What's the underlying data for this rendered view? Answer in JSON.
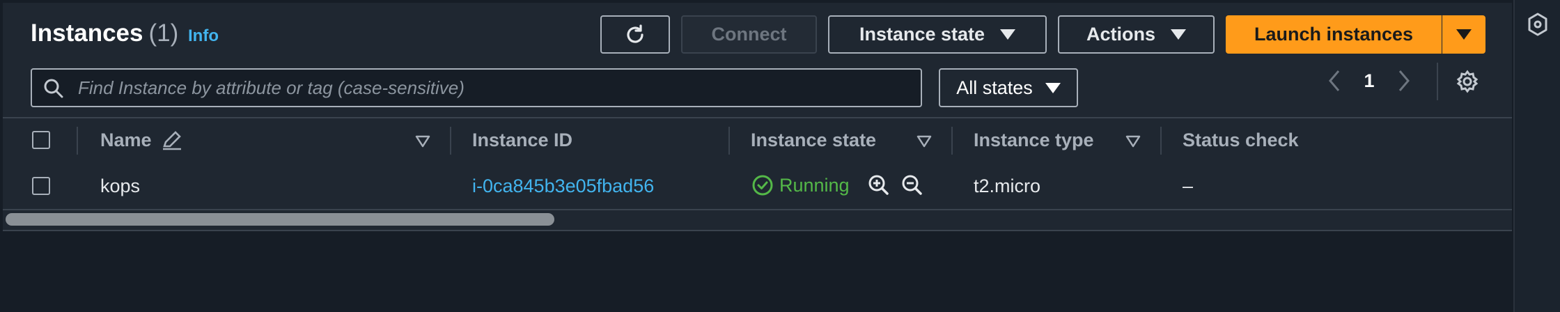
{
  "header": {
    "title": "Instances",
    "count": "(1)",
    "info_link": "Info"
  },
  "toolbar": {
    "refresh_icon": "refresh-icon",
    "connect_label": "Connect",
    "instance_state_label": "Instance state",
    "actions_label": "Actions",
    "launch_label": "Launch instances"
  },
  "search": {
    "placeholder": "Find Instance by attribute or tag (case-sensitive)",
    "value": ""
  },
  "filter": {
    "selected": "All states"
  },
  "pagination": {
    "current_page": "1"
  },
  "table": {
    "columns": [
      "Name",
      "Instance ID",
      "Instance state",
      "Instance type",
      "Status check"
    ],
    "rows": [
      {
        "name": "kops",
        "instance_id": "i-0ca845b3e05fbad56",
        "state": "Running",
        "type": "t2.micro",
        "status_check": "–"
      }
    ]
  },
  "colors": {
    "accent": "#ff9b1a",
    "link": "#42b4ee",
    "running": "#54b848",
    "background": "#161d26"
  }
}
